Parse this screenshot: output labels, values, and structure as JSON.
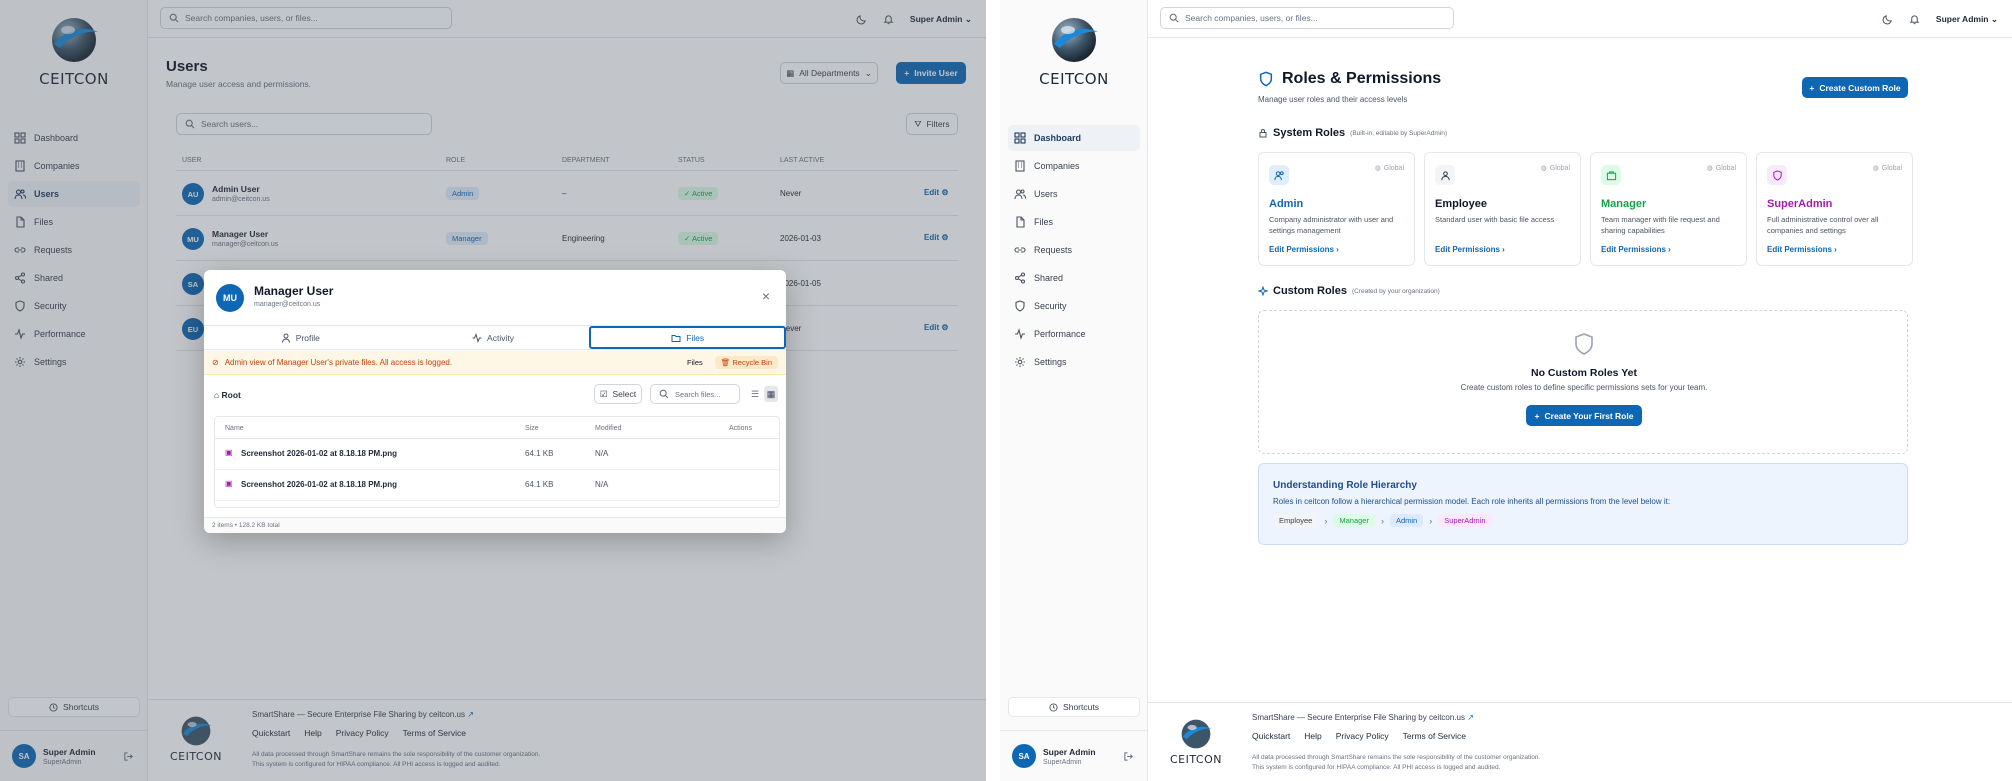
{
  "brand": {
    "logo_text": "CEITCON",
    "colors": {
      "primary": "#0e67b5",
      "success": "#16a34a",
      "purple": "#a21caf",
      "warning": "#c2410c"
    }
  },
  "nav_items": [
    {
      "label": "Dashboard",
      "icon": "dashboard-icon"
    },
    {
      "label": "Companies",
      "icon": "building-icon"
    },
    {
      "label": "Users",
      "icon": "users-icon"
    },
    {
      "label": "Files",
      "icon": "file-icon"
    },
    {
      "label": "Requests",
      "icon": "link-icon"
    },
    {
      "label": "Shared",
      "icon": "share-icon"
    },
    {
      "label": "Security",
      "icon": "shield-icon"
    },
    {
      "label": "Performance",
      "icon": "activity-icon"
    },
    {
      "label": "Settings",
      "icon": "gear-icon"
    }
  ],
  "shortcuts_label": "Shortcuts",
  "current_user": {
    "initials": "SA",
    "name": "Super Admin",
    "role": "SuperAdmin"
  },
  "topbar": {
    "search_placeholder": "Search companies, users, or files...",
    "user_label": "Super Admin"
  },
  "footer": {
    "tagline": "SmartShare — Secure Enterprise File Sharing by ceitcon.us",
    "links": [
      "Quickstart",
      "Help",
      "Privacy Policy",
      "Terms of Service"
    ],
    "note1": "All data processed through SmartShare remains the sole responsibility of the customer organization.",
    "note2": "This system is configured for HIPAA compliance. All PHI access is logged and audited."
  },
  "users_page": {
    "title": "Users",
    "subtitle": "Manage user access and permissions.",
    "dept_filter": "All Departments",
    "invite_button": "Invite User",
    "search_placeholder": "Search users...",
    "filters_button": "Filters",
    "columns": [
      "User",
      "Role",
      "Department",
      "Status",
      "Last Active"
    ],
    "edit_label": "Edit",
    "rows": [
      {
        "initials": "AU",
        "name": "Admin User",
        "email": "admin@ceitcon.us",
        "role": "Admin",
        "department": "–",
        "status": "Active",
        "last_active": "Never"
      },
      {
        "initials": "MU",
        "name": "Manager User",
        "email": "manager@ceitcon.us",
        "role": "Manager",
        "department": "Engineering",
        "status": "Active",
        "last_active": "2026-01-03"
      },
      {
        "initials": "SA",
        "last_active": "2026-01-05"
      },
      {
        "initials": "EU",
        "last_active": "Never"
      }
    ]
  },
  "modal": {
    "initials": "MU",
    "name": "Manager User",
    "email": "manager@ceitcon.us",
    "tabs": [
      "Profile",
      "Activity",
      "Files"
    ],
    "warning": "Admin view of Manager User's private files. All access is logged.",
    "files_label": "Files",
    "recycle_label": "Recycle Bin",
    "root_label": "Root",
    "select_label": "Select",
    "search_placeholder": "Search files...",
    "columns": [
      "Name",
      "Size",
      "Modified",
      "Actions"
    ],
    "files": [
      {
        "name": "Screenshot 2026-01-02 at 8.18.18 PM.png",
        "size": "64.1 KB",
        "modified": "N/A"
      },
      {
        "name": "Screenshot 2026-01-02 at 8.18.18 PM.png",
        "size": "64.1 KB",
        "modified": "N/A"
      }
    ],
    "summary": "2 items • 128.2 KB total"
  },
  "roles_page": {
    "title": "Roles & Permissions",
    "subtitle": "Manage user roles and their access levels",
    "create_button": "Create Custom Role",
    "system_title": "System Roles",
    "system_note": "(Built-in, editable by SuperAdmin)",
    "global_label": "Global",
    "edit_label": "Edit Permissions",
    "roles": [
      {
        "name": "Admin",
        "desc": "Company administrator with user and settings management",
        "color": "#0e67b5"
      },
      {
        "name": "Employee",
        "desc": "Standard user with basic file access",
        "color": "#111827"
      },
      {
        "name": "Manager",
        "desc": "Team manager with file request and sharing capabilities",
        "color": "#16a34a"
      },
      {
        "name": "SuperAdmin",
        "desc": "Full administrative control over all companies and settings",
        "color": "#a21caf"
      }
    ],
    "custom_title": "Custom Roles",
    "custom_note": "(Created by your organization)",
    "empty_title": "No Custom Roles Yet",
    "empty_desc": "Create custom roles to define specific permissions sets for your team.",
    "empty_button": "Create Your First Role",
    "hierarchy_title": "Understanding Role Hierarchy",
    "hierarchy_desc": "Roles in ceitcon follow a hierarchical permission model. Each role inherits all permissions from the level below it:",
    "hierarchy_chain": [
      "Employee",
      "Manager",
      "Admin",
      "SuperAdmin"
    ]
  }
}
